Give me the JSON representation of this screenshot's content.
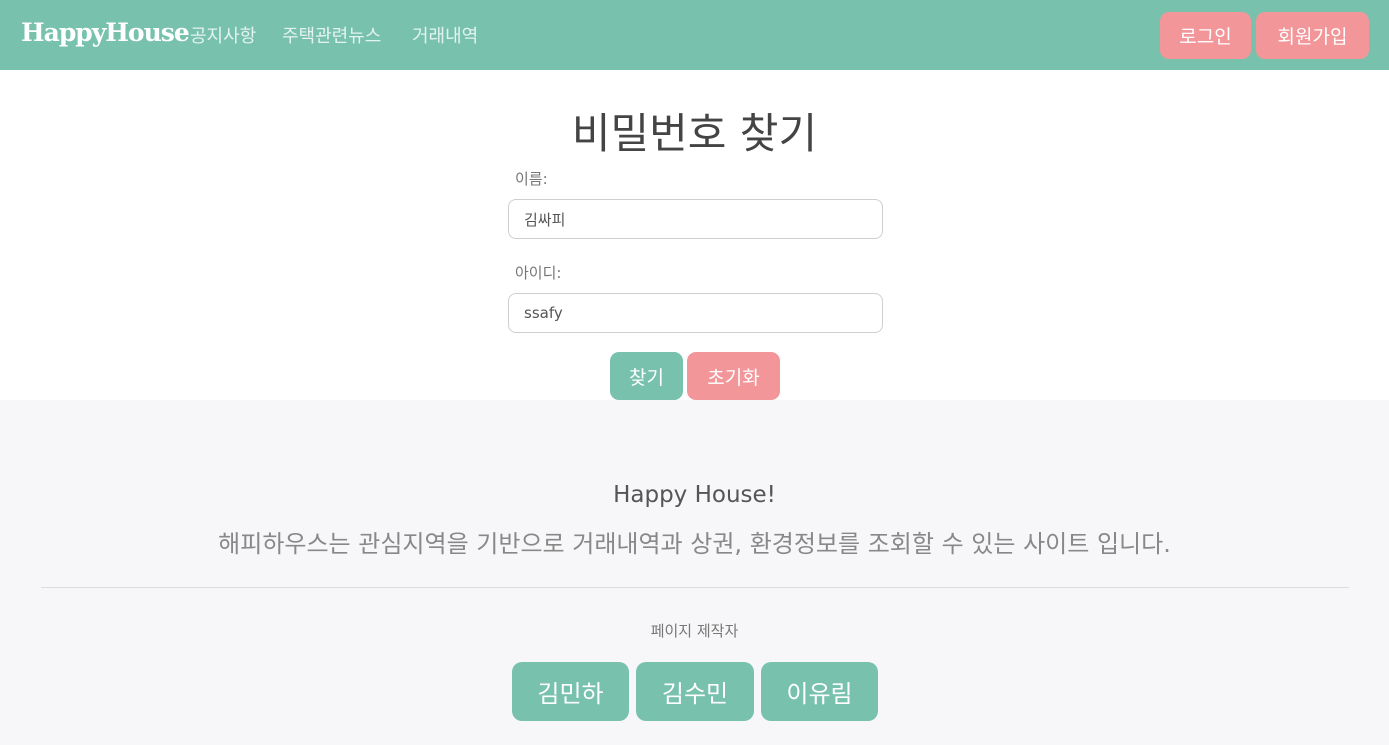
{
  "navbar": {
    "brand": "HappyHouse",
    "links": [
      "공지사항",
      "주택관련뉴스",
      "거래내역"
    ],
    "login_label": "로그인",
    "signup_label": "회원가입"
  },
  "form": {
    "title": "비밀번호 찾기",
    "name_label": "이름:",
    "name_value": "김싸피",
    "id_label": "아이디:",
    "id_value": "ssafy",
    "find_label": "찾기",
    "reset_label": "초기화"
  },
  "footer": {
    "title": "Happy House!",
    "description": "해피하우스는 관심지역을 기반으로 거래내역과 상권, 환경정보를 조회할 수 있는 사이트 입니다.",
    "makers_label": "페이지 제작자",
    "makers": [
      "김민하",
      "김수민",
      "이유림"
    ]
  },
  "colors": {
    "primary": "#78c2ad",
    "secondary": "#f3969a",
    "footer_bg": "#f7f7f9"
  }
}
